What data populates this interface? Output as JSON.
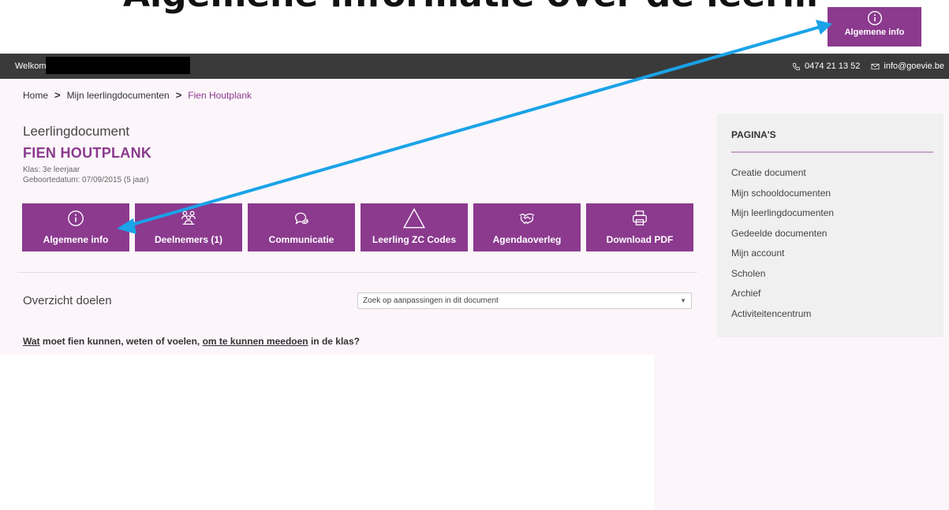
{
  "annotation": {
    "heading": "Algemene informatie over de leerling (bovenaan)",
    "callout_label": "Algemene info",
    "accent": "#8b3a8e",
    "arrow_color": "#1aa3e8"
  },
  "topbar": {
    "welcome": "Welkom",
    "phone": "0474 21 13 52",
    "email": "info@goevie.be"
  },
  "breadcrumb": {
    "home": "Home",
    "sep1": ">",
    "docs": "Mijn leerlingdocumenten",
    "sep2": ">",
    "current": "Fien Houtplank"
  },
  "document": {
    "label": "Leerlingdocument",
    "name": "FIEN HOUTPLANK",
    "klas": "Klas: 3e leerjaar",
    "dob": "Geboortedatum: 07/09/2015 (5 jaar)"
  },
  "tiles": [
    {
      "label": "Algemene info",
      "icon": "info-icon"
    },
    {
      "label": "Deelnemers (1)",
      "icon": "group-icon"
    },
    {
      "label": "Communicatie",
      "icon": "chat-icon"
    },
    {
      "label": "Leerling ZC Codes",
      "icon": "triangle-icon"
    },
    {
      "label": "Agendaoverleg",
      "icon": "handshake-icon"
    },
    {
      "label": "Download PDF",
      "icon": "printer-icon"
    }
  ],
  "overview": {
    "title": "Overzicht doelen",
    "search_value": "Zoek op aanpassingen in dit document"
  },
  "question": {
    "part1": "Wat",
    "part2": " moet fien kunnen, weten of voelen, ",
    "part3": "om te kunnen meedoen",
    "part4": " in de klas?"
  },
  "sidebar": {
    "title": "PAGINA'S",
    "items": [
      "Creatie document",
      "Mijn schooldocumenten",
      "Mijn leerlingdocumenten",
      "Gedeelde documenten",
      "Mijn account",
      "Scholen",
      "Archief",
      "Activiteitencentrum"
    ]
  }
}
